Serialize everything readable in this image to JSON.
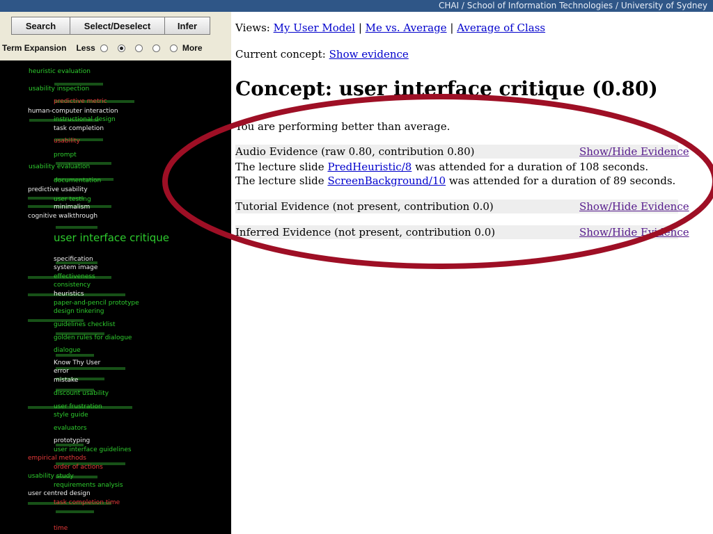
{
  "banner": "CHAI / School of Information Technologies / University of Sydney",
  "toolbar": {
    "search": "Search",
    "select": "Select/Deselect",
    "infer": "Infer"
  },
  "term_expansion": {
    "label": "Term Expansion",
    "less": "Less",
    "more": "More",
    "selected_index": 1
  },
  "colors": {
    "term_green": "#2ecc2e",
    "term_white": "#f0f0f0",
    "term_red": "#e83a3a",
    "annotation": "#9e0f25"
  },
  "concept_map": {
    "terms": [
      {
        "text": "heuristic evaluation",
        "color": "green"
      },
      {
        "text": "usability inspection",
        "color": "green"
      },
      {
        "text": "predictive metric",
        "color": "red"
      },
      {
        "text": "human-computer interaction",
        "color": "white"
      },
      {
        "text": "instructional design",
        "color": "green"
      },
      {
        "text": "task completion",
        "color": "white"
      },
      {
        "text": "usability",
        "color": "red"
      },
      {
        "text": "prompt",
        "color": "green"
      },
      {
        "text": "usability evaluation",
        "color": "green"
      },
      {
        "text": "documentation",
        "color": "green"
      },
      {
        "text": "predictive usability",
        "color": "white"
      },
      {
        "text": "user testing",
        "color": "green"
      },
      {
        "text": "minimalism",
        "color": "white"
      },
      {
        "text": "cognitive walkthrough",
        "color": "white"
      },
      {
        "text": "user interface critique",
        "color": "green"
      },
      {
        "text": "specification",
        "color": "white"
      },
      {
        "text": "system image",
        "color": "white"
      },
      {
        "text": "effectiveness",
        "color": "green"
      },
      {
        "text": "consistency",
        "color": "green"
      },
      {
        "text": "heuristics",
        "color": "white"
      },
      {
        "text": "paper-and-pencil prototype",
        "color": "green"
      },
      {
        "text": "design tinkering",
        "color": "green"
      },
      {
        "text": "guidelines checklist",
        "color": "green"
      },
      {
        "text": "golden rules for dialogue",
        "color": "green"
      },
      {
        "text": "dialogue",
        "color": "green"
      },
      {
        "text": "Know Thy User",
        "color": "white"
      },
      {
        "text": "error",
        "color": "white"
      },
      {
        "text": "mistake",
        "color": "white"
      },
      {
        "text": "discount usability",
        "color": "green"
      },
      {
        "text": "user frustration",
        "color": "green"
      },
      {
        "text": "style guide",
        "color": "green"
      },
      {
        "text": "evaluators",
        "color": "green"
      },
      {
        "text": "prototyping",
        "color": "white"
      },
      {
        "text": "user interface guidelines",
        "color": "green"
      },
      {
        "text": "empirical methods",
        "color": "red"
      },
      {
        "text": "order of actions",
        "color": "red"
      },
      {
        "text": "usability study",
        "color": "green"
      },
      {
        "text": "requirements analysis",
        "color": "green"
      },
      {
        "text": "user centred design",
        "color": "white"
      },
      {
        "text": "task completion time",
        "color": "red"
      },
      {
        "text": "time",
        "color": "red"
      }
    ]
  },
  "views": {
    "prefix": "Views:",
    "my_model": "My User Model",
    "sep": "|",
    "vs_avg": "Me vs. Average",
    "class_avg": "Average of Class"
  },
  "current": {
    "prefix": "Current concept:",
    "link": "Show evidence"
  },
  "concept": {
    "title": "Concept: user interface critique (0.80)",
    "performance": "You are performing better than average."
  },
  "evidence": {
    "audio": {
      "header": "Audio Evidence (raw 0.80, contribution 0.80)",
      "toggle": "Show/Hide Evidence",
      "line1_pre": "The lecture slide",
      "line1_link": "PredHeuristic/8",
      "line1_post": "was attended for a duration of 108 seconds.",
      "line2_pre": "The lecture slide",
      "line2_link": "ScreenBackground/10",
      "line2_post": "was attended for a duration of 89 seconds."
    },
    "tutorial": {
      "header": "Tutorial Evidence (not present, contribution 0.0)",
      "toggle": "Show/Hide Evidence"
    },
    "inferred": {
      "header": "Inferred Evidence (not present, contribution 0.0)",
      "toggle": "Show/Hide Evidence"
    }
  }
}
